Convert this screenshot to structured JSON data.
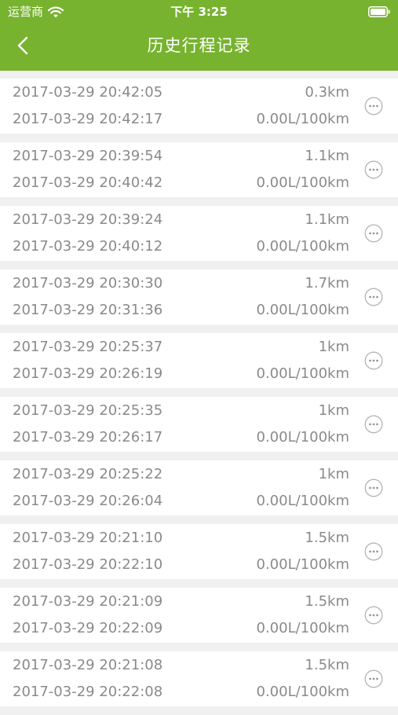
{
  "status_bar": {
    "carrier": "运营商",
    "time": "下午 3:25"
  },
  "nav": {
    "back_glyph": "<",
    "title": "历史行程记录"
  },
  "colors": {
    "header_bg": "#77b32f",
    "row_text": "#8a8a8a",
    "list_bg": "#f0f0f0"
  },
  "icons": {
    "more": "more-options-icon",
    "wifi": "wifi-icon",
    "battery": "battery-icon"
  },
  "trips": [
    {
      "start": "2017-03-29 20:42:05",
      "end": "2017-03-29 20:42:17",
      "distance": "0.3km",
      "fuel": "0.00L/100km"
    },
    {
      "start": "2017-03-29 20:39:54",
      "end": "2017-03-29 20:40:42",
      "distance": "1.1km",
      "fuel": "0.00L/100km"
    },
    {
      "start": "2017-03-29 20:39:24",
      "end": "2017-03-29 20:40:12",
      "distance": "1.1km",
      "fuel": "0.00L/100km"
    },
    {
      "start": "2017-03-29 20:30:30",
      "end": "2017-03-29 20:31:36",
      "distance": "1.7km",
      "fuel": "0.00L/100km"
    },
    {
      "start": "2017-03-29 20:25:37",
      "end": "2017-03-29 20:26:19",
      "distance": "1km",
      "fuel": "0.00L/100km"
    },
    {
      "start": "2017-03-29 20:25:35",
      "end": "2017-03-29 20:26:17",
      "distance": "1km",
      "fuel": "0.00L/100km"
    },
    {
      "start": "2017-03-29 20:25:22",
      "end": "2017-03-29 20:26:04",
      "distance": "1km",
      "fuel": "0.00L/100km"
    },
    {
      "start": "2017-03-29 20:21:10",
      "end": "2017-03-29 20:22:10",
      "distance": "1.5km",
      "fuel": "0.00L/100km"
    },
    {
      "start": "2017-03-29 20:21:09",
      "end": "2017-03-29 20:22:09",
      "distance": "1.5km",
      "fuel": "0.00L/100km"
    },
    {
      "start": "2017-03-29 20:21:08",
      "end": "2017-03-29 20:22:08",
      "distance": "1.5km",
      "fuel": "0.00L/100km"
    }
  ]
}
